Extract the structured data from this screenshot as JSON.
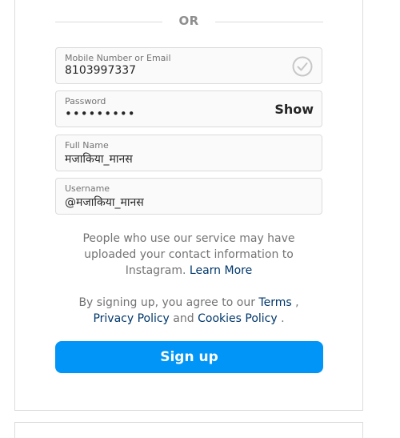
{
  "divider": {
    "label": "OR"
  },
  "fields": {
    "contact": {
      "label": "Mobile Number or Email",
      "value": "8103997337",
      "status_icon": "check-circle-icon"
    },
    "password": {
      "label": "Password",
      "value": "•••••••••",
      "toggle_label": "Show"
    },
    "full_name": {
      "label": "Full Name",
      "value": "मजाकिया_मानस"
    },
    "username": {
      "label": "Username",
      "value": "@मजाकिया_मानस"
    }
  },
  "notice": {
    "text": "People who use our service may have uploaded your contact information to Instagram. ",
    "link": "Learn More"
  },
  "terms": {
    "prefix": "By signing up, you agree to our ",
    "terms_link": "Terms",
    "sep1": " , ",
    "privacy_link": "Privacy Policy",
    "and": " and ",
    "cookies_link": "Cookies Policy",
    "suffix": " ."
  },
  "signup_button": {
    "label": "Sign up"
  },
  "colors": {
    "primary": "#0095f6",
    "link": "#00376b",
    "border": "#dbdbdb",
    "muted": "#737373"
  }
}
